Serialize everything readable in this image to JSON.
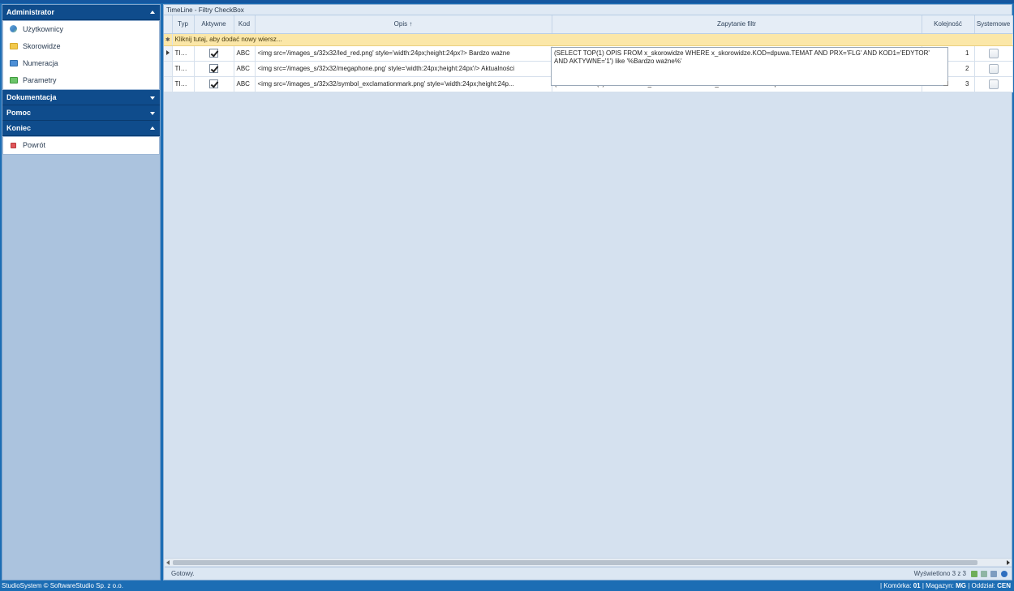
{
  "sidebar": {
    "groups": [
      {
        "title": "Administrator",
        "expanded": true,
        "items": [
          {
            "label": "Użytkownicy",
            "icon": "users-icon"
          },
          {
            "label": "Skorowidze",
            "icon": "folder-icon"
          },
          {
            "label": "Numeracja",
            "icon": "numbering-icon"
          },
          {
            "label": "Parametry",
            "icon": "parameters-icon"
          }
        ]
      },
      {
        "title": "Dokumentacja",
        "expanded": false
      },
      {
        "title": "Pomoc",
        "expanded": false
      },
      {
        "title": "Koniec",
        "expanded": true,
        "items": [
          {
            "label": "Powrót",
            "icon": "back-icon"
          }
        ]
      }
    ]
  },
  "panel": {
    "title": "TimeLine - Filtry CheckBox"
  },
  "grid": {
    "columns": [
      "Typ",
      "Aktywne",
      "Kod",
      "Opis ↑",
      "Zapytanie filtr",
      "Kolejność",
      "Systemowe"
    ],
    "new_row_text": "Kliknij tutaj, aby dodać nowy wiersz...",
    "rows": [
      {
        "typ": "TIMLF",
        "aktywne": true,
        "kod": "ABC",
        "opis": "<img src='/images_s/32x32/led_red.png' style='width:24px;height:24px'/> Bardzo ważne",
        "zapytanie": "",
        "kolejnosc": "1",
        "systemowe": false,
        "current": true
      },
      {
        "typ": "TIMLF",
        "aktywne": true,
        "kod": "ABC",
        "opis": "<img src='/images_s/32x32/megaphone.png' style='width:24px;height:24px'/> Aktualności",
        "zapytanie": "",
        "kolejnosc": "2",
        "systemowe": false,
        "current": false
      },
      {
        "typ": "TIMLF",
        "aktywne": true,
        "kod": "ABC",
        "opis": "<img src='/images_s/32x32/symbol_exclamationmark.png' style='width:24px;height:24p...",
        "zapytanie": "(SELECT TOP(1) OPIS FROM x_skorowidze WHERE x_skorowidze.KOD=dpuwa.TEMAT AND PRX='FLG' AND KOD1= ...",
        "kolejnosc": "3",
        "systemowe": false,
        "current": false
      }
    ],
    "editor_text": "(SELECT TOP(1) OPIS FROM x_skorowidze WHERE x_skorowidze.KOD=dpuwa.TEMAT AND PRX='FLG' AND KOD1='EDYTOR'\nAND AKTYWNE='1') like '%Bardzo ważne%'"
  },
  "statusbar": {
    "status": "Gotowy.",
    "shown": "Wyświetlono 3 z 3"
  },
  "footer": {
    "left": "StudioSystem © SoftwareStudio Sp. z o.o.",
    "komorka_label": "Komórka:",
    "komorka_value": "01",
    "magazyn_label": "Magazyn:",
    "magazyn_value": "MG",
    "oddzial_label": "Oddział:",
    "oddzial_value": "CEN"
  }
}
